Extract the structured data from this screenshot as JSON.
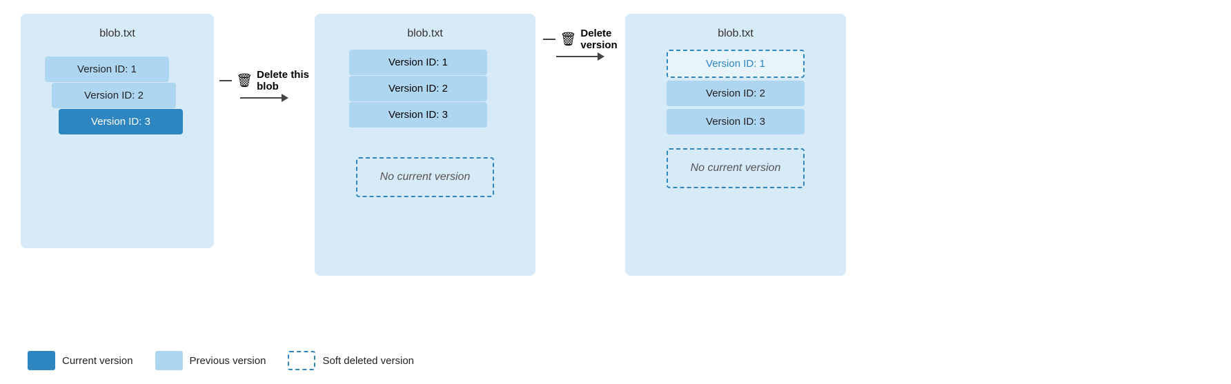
{
  "diagrams": {
    "title1": "blob.txt",
    "title2": "blob.txt",
    "title3": "blob.txt",
    "version1_label": "Version ID: 1",
    "version2_label": "Version ID: 2",
    "version3_label": "Version ID: 3",
    "no_current_version": "No current version",
    "action1_icon": "🗑",
    "action1_label1": "Delete this",
    "action1_label2": "blob",
    "action2_icon": "🗑",
    "action2_label1": "Delete",
    "action2_label2": "version"
  },
  "legend": {
    "current_box_label": "Current version",
    "previous_box_label": "Previous version",
    "softdeleted_box_label": "Soft deleted version"
  }
}
